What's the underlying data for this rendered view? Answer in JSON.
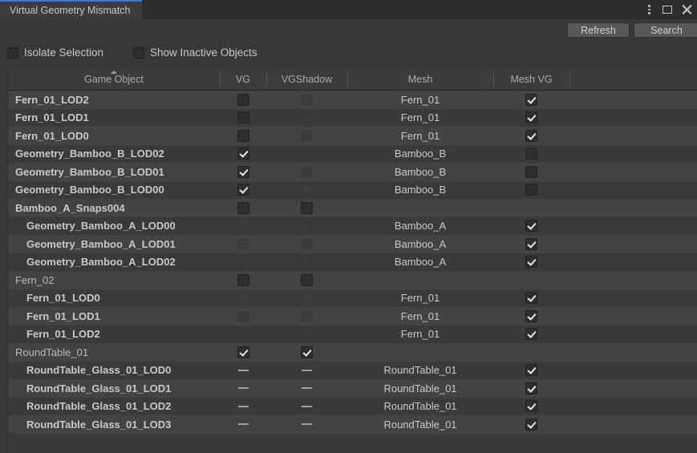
{
  "window": {
    "tab_title": "Virtual Geometry Mismatch",
    "controls": {
      "menu_icon": "kebab-menu-icon",
      "maximize_icon": "maximize-icon",
      "close_icon": "close-icon"
    }
  },
  "toolbar": {
    "refresh_label": "Refresh",
    "search_label": "Search",
    "isolate_selection_label": "Isolate Selection",
    "isolate_selection_checked": false,
    "show_inactive_label": "Show Inactive Objects",
    "show_inactive_checked": false,
    "search_value": "",
    "search_placeholder": "",
    "search_icon": "magnifier-icon"
  },
  "table": {
    "sort_column": "Game Object",
    "sort_direction": "ascending",
    "columns": [
      {
        "label": "Game Object",
        "key": "name"
      },
      {
        "label": "VG",
        "key": "vg"
      },
      {
        "label": "VGShadow",
        "key": "vgshadow"
      },
      {
        "label": "Mesh",
        "key": "mesh"
      },
      {
        "label": "Mesh VG",
        "key": "meshvg"
      }
    ],
    "rows": [
      {
        "name": "Fern_01_LOD2",
        "indent": 1,
        "vg": "unchecked",
        "vgshadow": "unchecked-disabled",
        "mesh": "Fern_01",
        "meshvg": "checked"
      },
      {
        "name": "Fern_01_LOD1",
        "indent": 1,
        "vg": "unchecked",
        "vgshadow": "unchecked-disabled",
        "mesh": "Fern_01",
        "meshvg": "checked"
      },
      {
        "name": "Fern_01_LOD0",
        "indent": 1,
        "vg": "unchecked",
        "vgshadow": "unchecked-disabled",
        "mesh": "Fern_01",
        "meshvg": "checked"
      },
      {
        "name": "Geometry_Bamboo_B_LOD02",
        "indent": 1,
        "vg": "checked",
        "vgshadow": "unchecked-disabled",
        "mesh": "Bamboo_B",
        "meshvg": "unchecked"
      },
      {
        "name": "Geometry_Bamboo_B_LOD01",
        "indent": 1,
        "vg": "checked",
        "vgshadow": "unchecked-disabled",
        "mesh": "Bamboo_B",
        "meshvg": "unchecked"
      },
      {
        "name": "Geometry_Bamboo_B_LOD00",
        "indent": 1,
        "vg": "checked",
        "vgshadow": "unchecked-disabled",
        "mesh": "Bamboo_B",
        "meshvg": "unchecked"
      },
      {
        "name": "Bamboo_A_Snaps004",
        "indent": 1,
        "vg": "unchecked",
        "vgshadow": "unchecked",
        "mesh": "",
        "meshvg": "none"
      },
      {
        "name": "Geometry_Bamboo_A_LOD00",
        "indent": 2,
        "vg": "unchecked-disabled",
        "vgshadow": "unchecked-disabled",
        "mesh": "Bamboo_A",
        "meshvg": "checked"
      },
      {
        "name": "Geometry_Bamboo_A_LOD01",
        "indent": 2,
        "vg": "unchecked-disabled",
        "vgshadow": "unchecked-disabled",
        "mesh": "Bamboo_A",
        "meshvg": "checked"
      },
      {
        "name": "Geometry_Bamboo_A_LOD02",
        "indent": 2,
        "vg": "unchecked-disabled",
        "vgshadow": "unchecked-disabled",
        "mesh": "Bamboo_A",
        "meshvg": "checked"
      },
      {
        "name": "Fern_02",
        "indent": 0,
        "vg": "unchecked",
        "vgshadow": "unchecked",
        "mesh": "",
        "meshvg": "none"
      },
      {
        "name": "Fern_01_LOD0",
        "indent": 2,
        "vg": "unchecked-disabled",
        "vgshadow": "unchecked-disabled",
        "mesh": "Fern_01",
        "meshvg": "checked"
      },
      {
        "name": "Fern_01_LOD1",
        "indent": 2,
        "vg": "unchecked-disabled",
        "vgshadow": "unchecked-disabled",
        "mesh": "Fern_01",
        "meshvg": "checked"
      },
      {
        "name": "Fern_01_LOD2",
        "indent": 2,
        "vg": "unchecked-disabled",
        "vgshadow": "unchecked-disabled",
        "mesh": "Fern_01",
        "meshvg": "checked"
      },
      {
        "name": "RoundTable_01",
        "indent": 0,
        "vg": "checked",
        "vgshadow": "checked",
        "mesh": "",
        "meshvg": "none"
      },
      {
        "name": "RoundTable_Glass_01_LOD0",
        "indent": 2,
        "vg": "dash",
        "vgshadow": "dash",
        "mesh": "RoundTable_01",
        "meshvg": "checked"
      },
      {
        "name": "RoundTable_Glass_01_LOD1",
        "indent": 2,
        "vg": "dash",
        "vgshadow": "dash",
        "mesh": "RoundTable_01",
        "meshvg": "checked"
      },
      {
        "name": "RoundTable_Glass_01_LOD2",
        "indent": 2,
        "vg": "dash",
        "vgshadow": "dash",
        "mesh": "RoundTable_01",
        "meshvg": "checked"
      },
      {
        "name": "RoundTable_Glass_01_LOD3",
        "indent": 2,
        "vg": "dash",
        "vgshadow": "dash",
        "mesh": "RoundTable_01",
        "meshvg": "checked"
      }
    ]
  },
  "colors": {
    "tab_accent": "#3b7fc4",
    "window_bg": "#383838",
    "row_odd": "#434343",
    "row_even": "#3a3a3a"
  }
}
